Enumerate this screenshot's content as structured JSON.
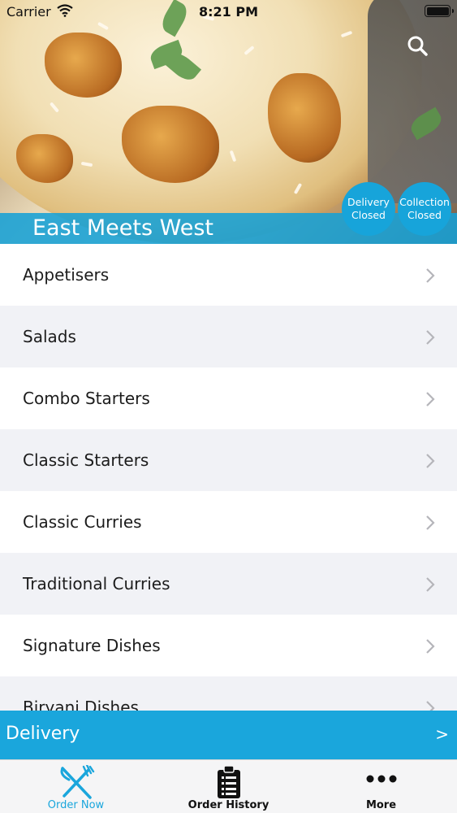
{
  "status_bar": {
    "carrier": "Carrier",
    "time": "8:21 PM",
    "icons": [
      "wifi-icon",
      "battery-icon"
    ]
  },
  "header": {
    "restaurant_name": "East Meets West",
    "search_icon": "search-icon",
    "delivery_status": {
      "line1": "Delivery",
      "line2": "Closed"
    },
    "collection_status": {
      "line1": "Collection",
      "line2": "Closed"
    }
  },
  "menu": {
    "categories": [
      {
        "label": "Appetisers"
      },
      {
        "label": "Salads"
      },
      {
        "label": "Combo Starters"
      },
      {
        "label": "Classic Starters"
      },
      {
        "label": "Classic Curries"
      },
      {
        "label": "Traditional Curries"
      },
      {
        "label": "Signature Dishes"
      },
      {
        "label": "Biryani Dishes"
      }
    ],
    "chevron_icon": "chevron-right-icon"
  },
  "order_type_bar": {
    "label": "Delivery",
    "arrow": ">"
  },
  "tabbar": {
    "tabs": [
      {
        "label": "Order Now",
        "icon": "fork-knife-icon",
        "active": true
      },
      {
        "label": "Order History",
        "icon": "clipboard-list-icon",
        "active": false
      },
      {
        "label": "More",
        "icon": "more-dots-icon",
        "active": false
      }
    ]
  },
  "colors": {
    "accent": "#1aa6dc",
    "row_alt": "#f1f2f6",
    "text": "#1c1c1c"
  }
}
